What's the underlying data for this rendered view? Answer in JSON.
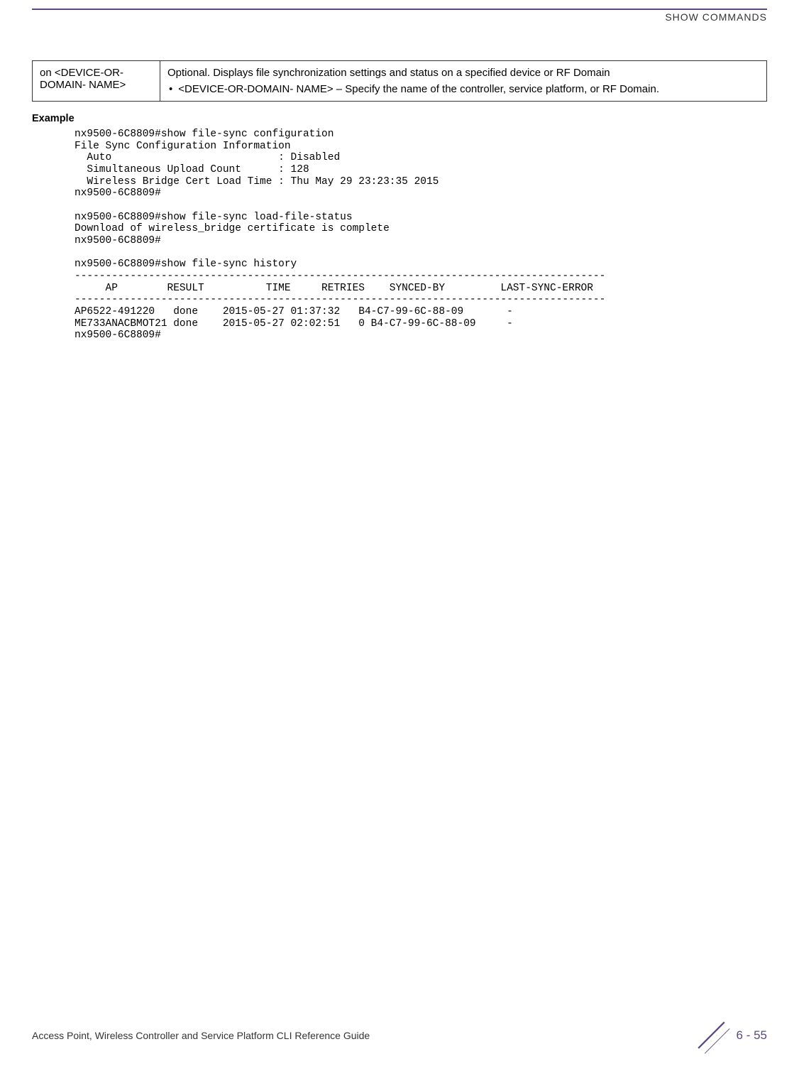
{
  "header": {
    "section": "SHOW COMMANDS"
  },
  "table": {
    "param": "on <DEVICE-OR-DOMAIN- NAME>",
    "desc_main": "Optional. Displays file synchronization settings and status on a specified device or RF Domain",
    "bullet": "<DEVICE-OR-DOMAIN- NAME> – Specify the name of the controller, service platform, or RF Domain."
  },
  "example_heading": "Example",
  "terminal": "nx9500-6C8809#show file-sync configuration\nFile Sync Configuration Information\n  Auto                           : Disabled\n  Simultaneous Upload Count      : 128\n  Wireless Bridge Cert Load Time : Thu May 29 23:23:35 2015\nnx9500-6C8809#\n\nnx9500-6C8809#show file-sync load-file-status\nDownload of wireless_bridge certificate is complete\nnx9500-6C8809#\n\nnx9500-6C8809#show file-sync history\n--------------------------------------------------------------------------------------\n     AP        RESULT          TIME     RETRIES    SYNCED-BY         LAST-SYNC-ERROR\n--------------------------------------------------------------------------------------\nAP6522-491220   done    2015-05-27 01:37:32   B4-C7-99-6C-88-09       -\nME733ANACBMOT21 done    2015-05-27 02:02:51   0 B4-C7-99-6C-88-09     -\nnx9500-6C8809#",
  "footer": {
    "doc_title": "Access Point, Wireless Controller and Service Platform CLI Reference Guide",
    "page": "6 - 55"
  }
}
